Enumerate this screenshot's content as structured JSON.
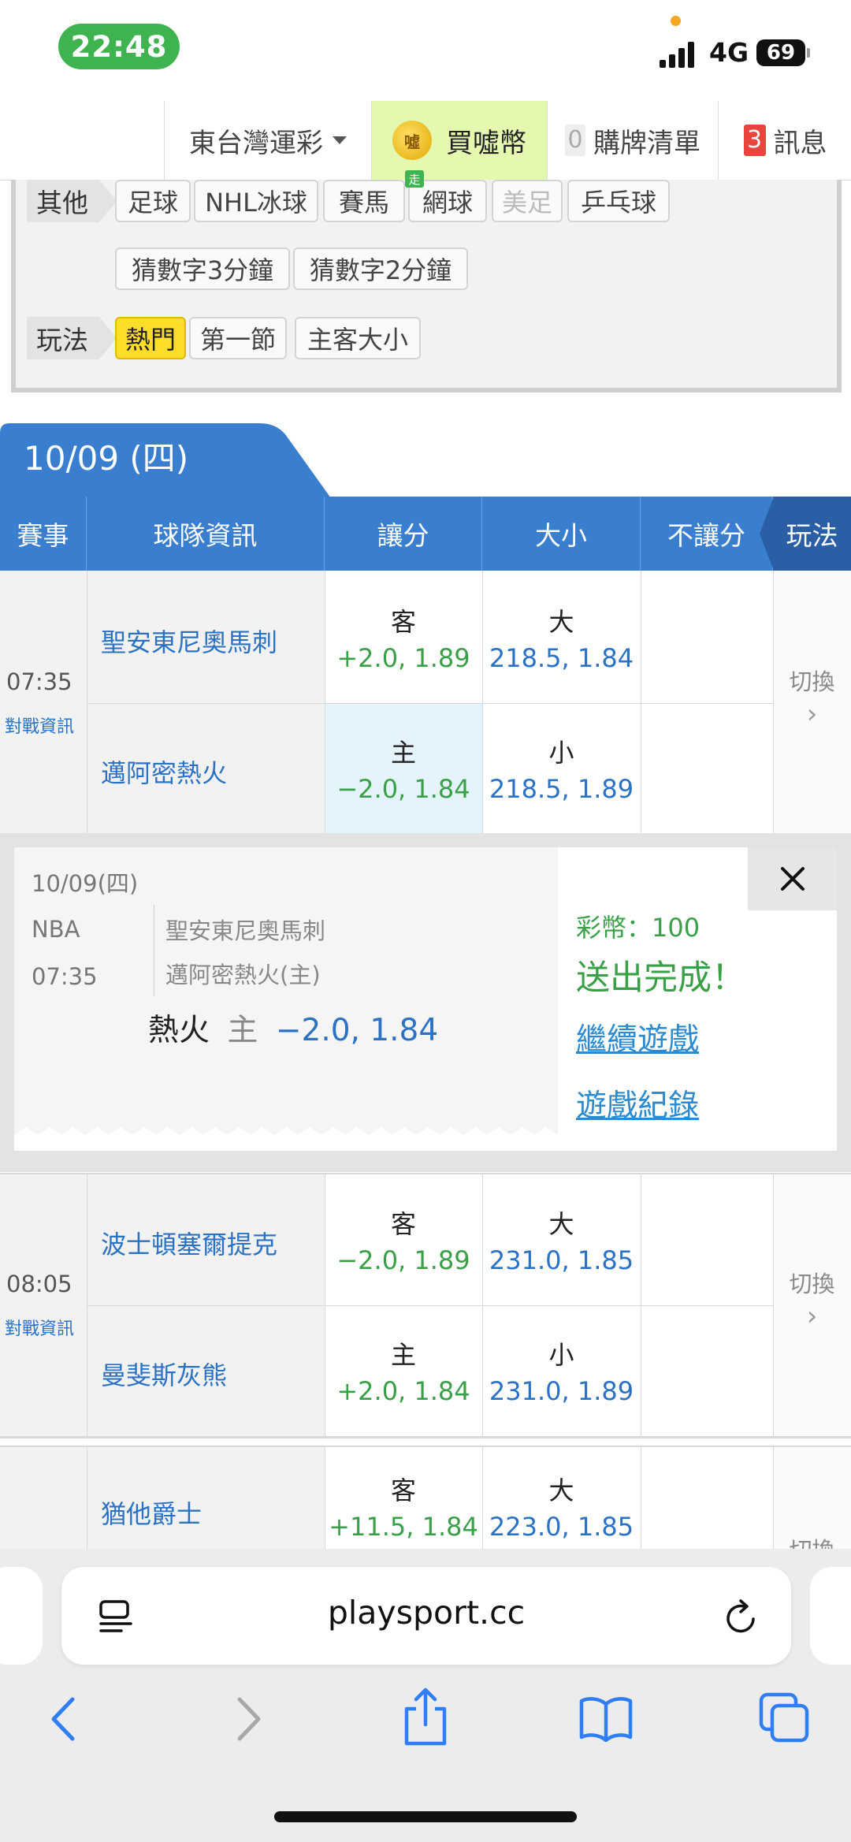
{
  "status": {
    "time": "22:48",
    "network": "4G",
    "battery": "69"
  },
  "nav": {
    "region": "東台灣運彩",
    "coin_icon_text": "噓",
    "buy": "買噓幣",
    "list_count": "0",
    "list_label": "購牌清單",
    "msg_count": "3",
    "msg_label": "訊息"
  },
  "filters": {
    "other_label": "其他",
    "sports": [
      "足球",
      "NHL冰球",
      "賽馬",
      "網球",
      "美足",
      "乒乓球"
    ],
    "live_mark": "走",
    "games": [
      "猜數字3分鐘",
      "猜數字2分鐘"
    ],
    "play_label": "玩法",
    "plays": [
      "熱門",
      "第一節",
      "主客大小"
    ]
  },
  "date": "10/09 (四)",
  "table_headers": {
    "event": "賽事",
    "team": "球隊資訊",
    "spread": "讓分",
    "total": "大小",
    "moneyline": "不讓分",
    "play": "玩法"
  },
  "matches": [
    {
      "time": "07:35",
      "info": "對戰資訊",
      "switch": "切換",
      "away": {
        "team": "聖安東尼奧馬刺",
        "side": "客",
        "spread": "+2.0, 1.89",
        "ou_side": "大",
        "ou": "218.5, 1.84"
      },
      "home": {
        "team": "邁阿密熱火",
        "side": "主",
        "spread": "−2.0, 1.84",
        "ou_side": "小",
        "ou": "218.5, 1.89"
      }
    },
    {
      "time": "08:05",
      "info": "對戰資訊",
      "switch": "切換",
      "away": {
        "team": "波士頓塞爾提克",
        "side": "客",
        "spread": "−2.0, 1.89",
        "ou_side": "大",
        "ou": "231.0, 1.85"
      },
      "home": {
        "team": "曼斐斯灰熊",
        "side": "主",
        "spread": "+2.0, 1.84",
        "ou_side": "小",
        "ou": "231.0, 1.89"
      }
    },
    {
      "time": "",
      "info": "",
      "switch": "切換",
      "away": {
        "team": "猶他爵士",
        "side": "客",
        "spread": "+11.5, 1.84",
        "ou_side": "大",
        "ou": "223.0, 1.85"
      }
    }
  ],
  "popup": {
    "date": "10/09(四)",
    "league": "NBA",
    "time": "07:35",
    "away_team": "聖安東尼奧馬刺",
    "home_team": "邁阿密熱火(主)",
    "pick_team": "熱火",
    "pick_side": "主",
    "pick_odds": "−2.0, 1.84",
    "coins": "彩幣：100",
    "done": "送出完成！",
    "continue": "繼續遊戲",
    "records": "遊戲紀錄"
  },
  "browser": {
    "url": "playsport.cc"
  }
}
